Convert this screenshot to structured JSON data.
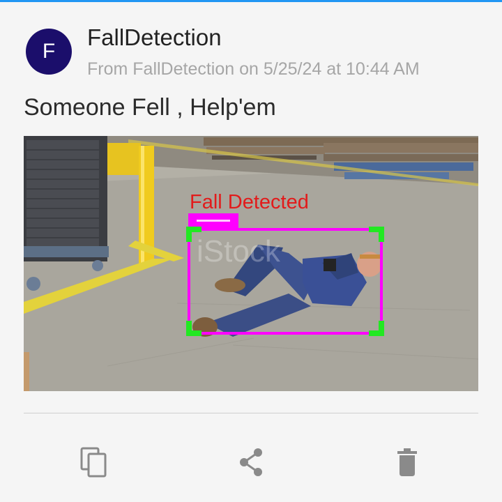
{
  "notification": {
    "avatar_letter": "F",
    "app_name": "FallDetection",
    "meta": "From FallDetection on 5/25/24 at 10:44 AM",
    "message": "Someone Fell , Help'em"
  },
  "image": {
    "overlay_label": "Fall Detected",
    "watermark": "iStock"
  },
  "actions": [
    {
      "name": "copy",
      "icon": "copy-icon"
    },
    {
      "name": "share",
      "icon": "share-icon"
    },
    {
      "name": "delete",
      "icon": "trash-icon"
    }
  ],
  "colors": {
    "accent": "#2196f3",
    "avatar": "#1b0e6b",
    "detection_box": "#ff00ff",
    "detection_corner": "#22e822",
    "detection_text": "#e21b1b"
  }
}
